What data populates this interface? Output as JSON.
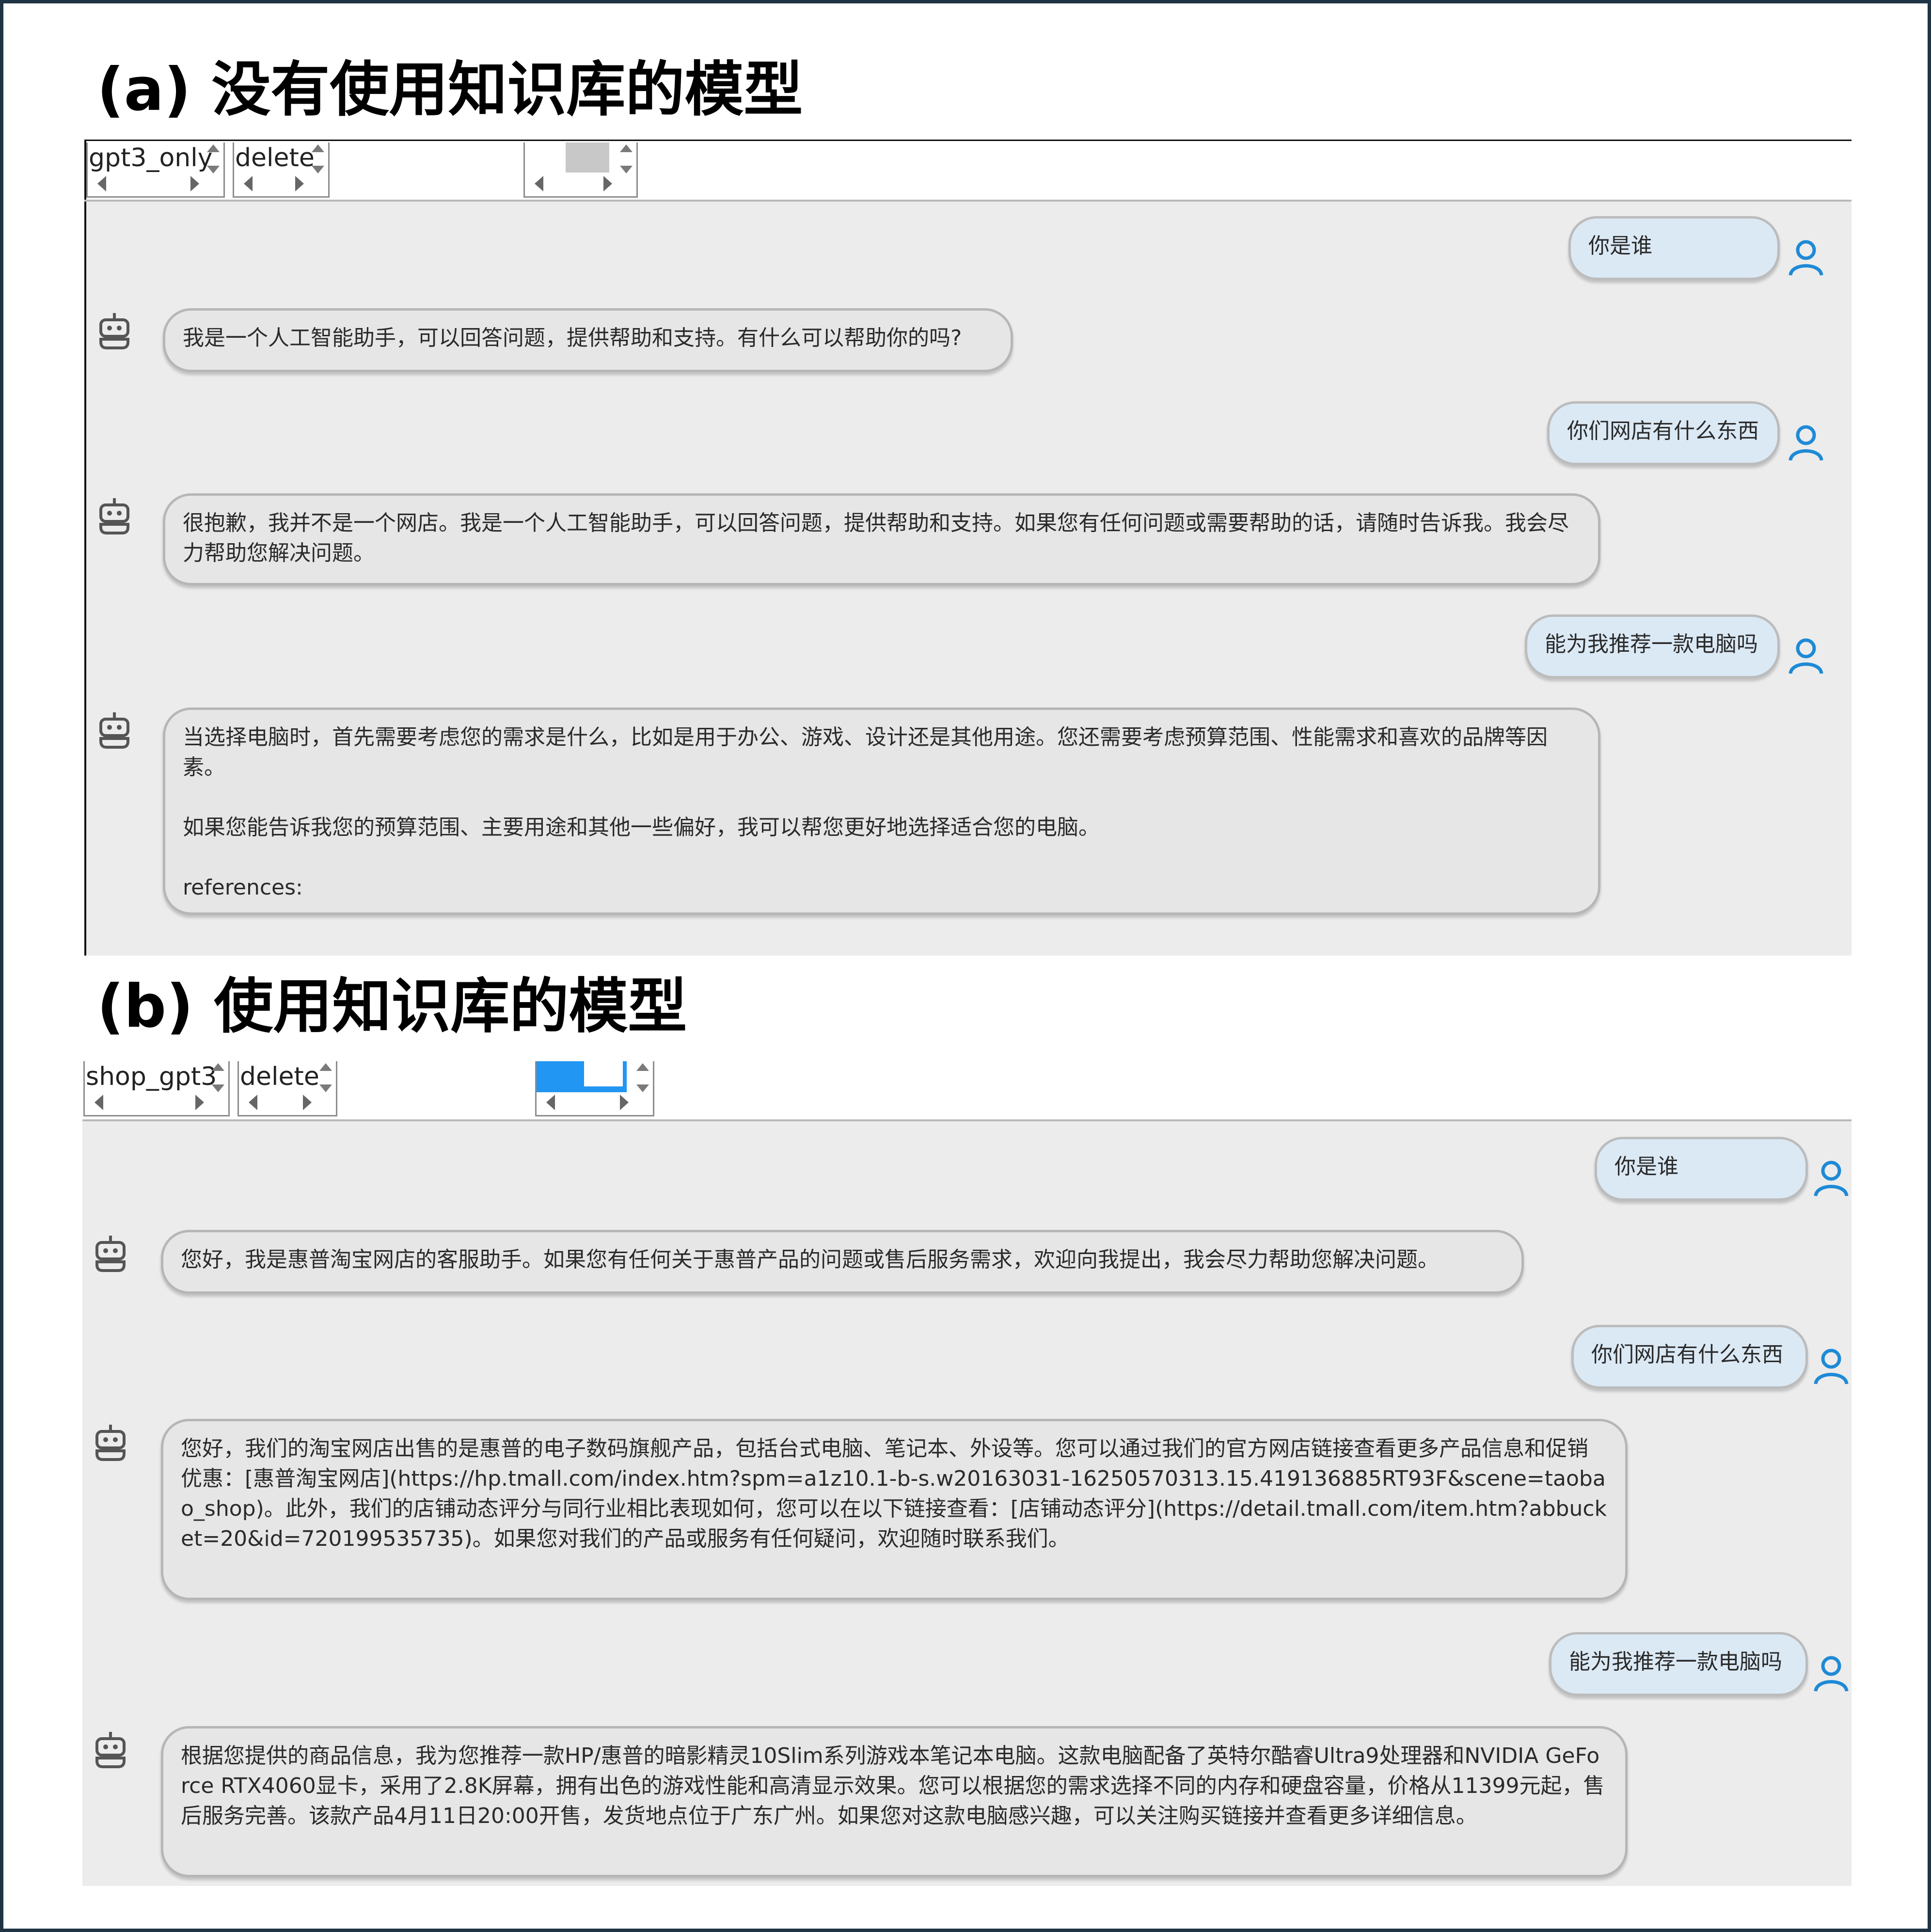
{
  "panel_a": {
    "title": "(a) 没有使用知识库的模型",
    "toolbar": {
      "model_select": "gpt3_only",
      "action_select": "delete"
    },
    "messages": [
      {
        "role": "user",
        "text": "你是谁"
      },
      {
        "role": "bot",
        "text": "我是一个人工智能助手，可以回答问题，提供帮助和支持。有什么可以帮助你的吗?"
      },
      {
        "role": "user",
        "text": "你们网店有什么东西"
      },
      {
        "role": "bot",
        "text": "很抱歉，我并不是一个网店。我是一个人工智能助手，可以回答问题，提供帮助和支持。如果您有任何问题或需要帮助的话，请随时告诉我。我会尽力帮助您解决问题。"
      },
      {
        "role": "user",
        "text": "能为我推荐一款电脑吗"
      },
      {
        "role": "bot",
        "text": "当选择电脑时，首先需要考虑您的需求是什么，比如是用于办公、游戏、设计还是其他用途。您还需要考虑预算范围、性能需求和喜欢的品牌等因素。\n\n如果您能告诉我您的预算范围、主要用途和其他一些偏好，我可以帮您更好地选择适合您的电脑。\n\nreferences:"
      }
    ]
  },
  "panel_b": {
    "title": "(b) 使用知识库的模型",
    "toolbar": {
      "model_select": "shop_gpt3",
      "action_select": "delete"
    },
    "messages": [
      {
        "role": "user",
        "text": "你是谁"
      },
      {
        "role": "bot",
        "text": "您好，我是惠普淘宝网店的客服助手。如果您有任何关于惠普产品的问题或售后服务需求，欢迎向我提出，我会尽力帮助您解决问题。"
      },
      {
        "role": "user",
        "text": "你们网店有什么东西"
      },
      {
        "role": "bot",
        "text": "您好，我们的淘宝网店出售的是惠普的电子数码旗舰产品，包括台式电脑、笔记本、外设等。您可以通过我们的官方网店链接查看更多产品信息和促销优惠：[惠普淘宝网店](https://hp.tmall.com/index.htm?spm=a1z10.1-b-s.w20163031-16250570313.15.419136885RT93F&scene=taobao_shop)。此外，我们的店铺动态评分与同行业相比表现如何，您可以在以下链接查看：[店铺动态评分](https://detail.tmall.com/item.htm?abbucket=20&id=720199535735)。如果您对我们的产品或服务有任何疑问，欢迎随时联系我们。"
      },
      {
        "role": "user",
        "text": "能为我推荐一款电脑吗"
      },
      {
        "role": "bot",
        "text": "根据您提供的商品信息，我为您推荐一款HP/惠普的暗影精灵10Slim系列游戏本笔记本电脑。这款电脑配备了英特尔酷睿Ultra9处理器和NVIDIA GeForce RTX4060显卡，采用了2.8K屏幕，拥有出色的游戏性能和高清显示效果。您可以根据您的需求选择不同的内存和硬盘容量，价格从11399元起，售后服务完善。该款产品4月11日20:00开售，发货地点位于广东广州。如果您对这款电脑感兴趣，可以关注购买链接并查看更多详细信息。"
      }
    ]
  },
  "colors": {
    "chat_bg": "#ececec",
    "user_bubble": "#dbe9f5",
    "bot_bubble": "#e6e6e6",
    "user_icon": "#1e8ad6",
    "bot_icon": "#555555",
    "spinner_fill_b": "#2196f3",
    "spinner_fill_a": "#c8c8c8"
  }
}
